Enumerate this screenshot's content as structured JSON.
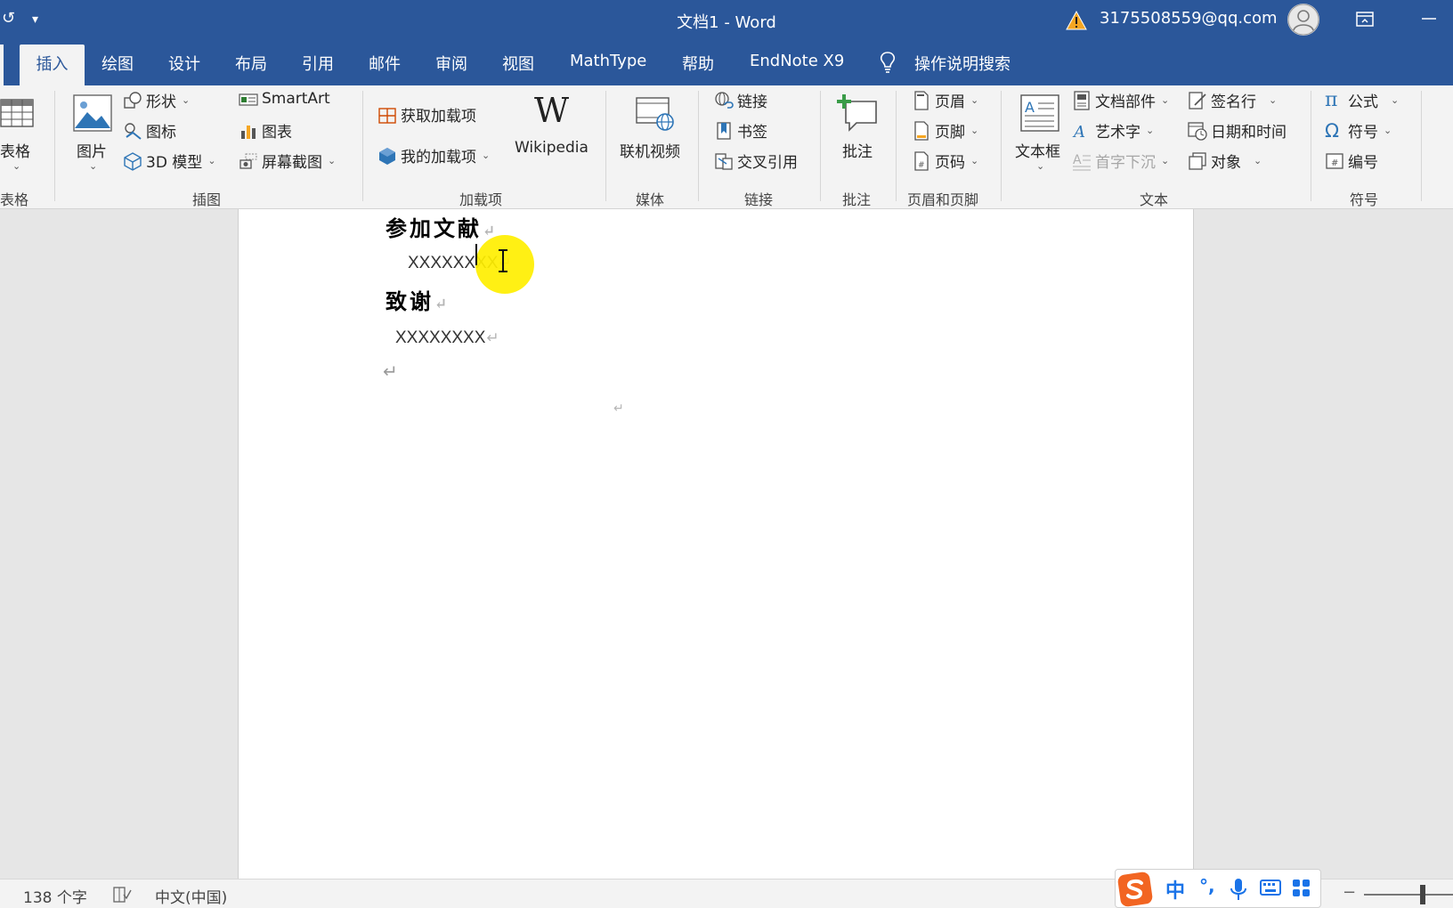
{
  "window": {
    "title": "文档1  -  Word",
    "account_email": "3175508559@qq.com",
    "quick_access": {
      "undo_glyph": "↺",
      "customize_glyph": "▾"
    }
  },
  "tabs": {
    "insert": "插入",
    "draw": "绘图",
    "design": "设计",
    "layout": "布局",
    "references": "引用",
    "mailings": "邮件",
    "review": "审阅",
    "view": "视图",
    "mathtype": "MathType",
    "help": "帮助",
    "endnote": "EndNote X9",
    "tell_me": "操作说明搜索"
  },
  "ribbon": {
    "tables": {
      "table_label": "表格",
      "group_label": "表格"
    },
    "illustrations": {
      "pictures": "图片",
      "shapes": "形状",
      "icons": "图标",
      "models_3d": "3D 模型",
      "smartart": "SmartArt",
      "chart": "图表",
      "screenshot": "屏幕截图",
      "group_label": "插图"
    },
    "addins": {
      "get_addins": "获取加载项",
      "my_addins": "我的加载项",
      "wikipedia": "Wikipedia",
      "wikipedia_glyph": "W",
      "group_label": "加载项"
    },
    "media": {
      "online_video": "联机视频",
      "group_label": "媒体"
    },
    "links": {
      "link": "链接",
      "bookmark": "书签",
      "cross_reference": "交叉引用",
      "group_label": "链接"
    },
    "comments": {
      "comment": "批注",
      "group_label": "批注"
    },
    "header_footer": {
      "header": "页眉",
      "footer": "页脚",
      "page_number": "页码",
      "group_label": "页眉和页脚"
    },
    "text": {
      "text_box": "文本框",
      "quick_parts": "文档部件",
      "wordart": "艺术字",
      "drop_cap": "首字下沉",
      "signature_line": "签名行",
      "date_time": "日期和时间",
      "object": "对象",
      "group_label": "文本"
    },
    "symbols": {
      "equation": "公式",
      "equation_glyph": "π",
      "symbol": "符号",
      "symbol_glyph": "Ω",
      "numbering": "编号",
      "group_label": "符号"
    }
  },
  "document": {
    "heading_references": "参加文献",
    "references_body": "XXXXXXXX",
    "heading_acknowledgement": "致谢",
    "acknowledgement_body": "XXXXXXXX",
    "paragraph_mark": "↵"
  },
  "statusbar": {
    "word_count": "138 个字",
    "language": "中文(中国)",
    "zoom_minus": "−",
    "ime": {
      "mode": "中",
      "punctuation": "°,"
    }
  },
  "colors": {
    "accent": "#2b579a",
    "ribbon_bg": "#f3f3f3",
    "canvas_bg": "#e6e6e6",
    "cursor_highlight": "#ffef00",
    "sogou_orange": "#f26522",
    "ime_blue": "#1a73e8"
  }
}
